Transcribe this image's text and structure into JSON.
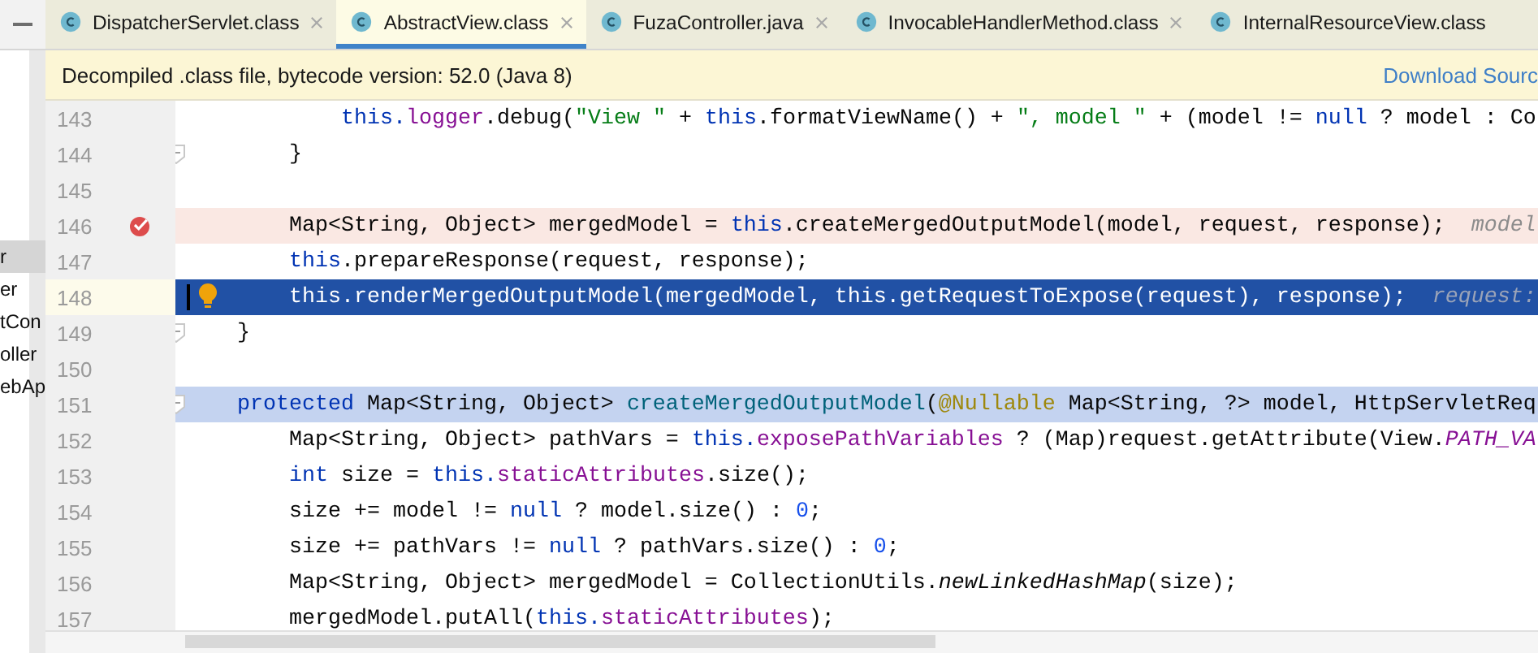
{
  "project_panel": {
    "items": [
      {
        "label": "r",
        "selected": true
      },
      {
        "label": "er",
        "selected": false
      },
      {
        "label": "tCon",
        "selected": false
      },
      {
        "label": "oller",
        "selected": false
      },
      {
        "label": "ebAp",
        "selected": false
      }
    ]
  },
  "tabs": [
    {
      "label": "DispatcherServlet.class",
      "selected": false,
      "closable": true
    },
    {
      "label": "AbstractView.class",
      "selected": true,
      "closable": true
    },
    {
      "label": "FuzaController.java",
      "selected": false,
      "closable": true
    },
    {
      "label": "InvocableHandlerMethod.class",
      "selected": false,
      "closable": true
    },
    {
      "label": "InternalResourceView.class",
      "selected": false,
      "closable": false
    }
  ],
  "banner": {
    "message": "Decompiled .class file, bytecode version: 52.0 (Java 8)",
    "link": "Download Sourc"
  },
  "editor": {
    "lines": [
      {
        "number": "143",
        "breakpoint": false,
        "current": false,
        "highlighted": false,
        "intention": false,
        "fold": false,
        "tokens": [
          {
            "text": "            this.",
            "kind": "keyword"
          },
          {
            "text": "logger",
            "kind": "field"
          },
          {
            "text": ".debug(",
            "kind": "plain"
          },
          {
            "text": "\"View \"",
            "kind": "string"
          },
          {
            "text": " + ",
            "kind": "plain"
          },
          {
            "text": "this",
            "kind": "keyword"
          },
          {
            "text": ".formatViewName() + ",
            "kind": "plain"
          },
          {
            "text": "\", model \"",
            "kind": "string"
          },
          {
            "text": " + (model != ",
            "kind": "plain"
          },
          {
            "text": "null",
            "kind": "keyword"
          },
          {
            "text": " ? model : Co",
            "kind": "plain"
          }
        ]
      },
      {
        "number": "144",
        "breakpoint": false,
        "current": false,
        "highlighted": false,
        "intention": false,
        "fold": true,
        "tokens": [
          {
            "text": "        }",
            "kind": "plain"
          }
        ]
      },
      {
        "number": "145",
        "breakpoint": false,
        "current": false,
        "highlighted": false,
        "intention": false,
        "fold": false
      },
      {
        "number": "146",
        "breakpoint": true,
        "current": false,
        "highlighted": false,
        "intention": false,
        "fold": false,
        "tokens": [
          {
            "text": "        Map<String, Object> mergedModel = ",
            "kind": "plain"
          },
          {
            "text": "this",
            "kind": "keyword"
          },
          {
            "text": ".createMergedOutputModel(model, request, response);",
            "kind": "plain"
          }
        ],
        "hint": "model"
      },
      {
        "number": "147",
        "breakpoint": false,
        "current": false,
        "highlighted": false,
        "intention": false,
        "fold": false,
        "tokens": [
          {
            "text": "        this",
            "kind": "keyword"
          },
          {
            "text": ".prepareResponse(request, response);",
            "kind": "plain"
          }
        ]
      },
      {
        "number": "148",
        "breakpoint": false,
        "current": true,
        "highlighted": false,
        "intention": true,
        "fold": false,
        "tokens": [
          {
            "text": "        this",
            "kind": "keyword"
          },
          {
            "text": ".renderMergedOutputModel(mergedModel, ",
            "kind": "plain"
          },
          {
            "text": "this",
            "kind": "keyword"
          },
          {
            "text": ".getRequestToExpose(request), response);",
            "kind": "plain"
          }
        ],
        "hint": "request:"
      },
      {
        "number": "149",
        "breakpoint": false,
        "current": false,
        "highlighted": false,
        "intention": false,
        "fold": true,
        "tokens": [
          {
            "text": "    }",
            "kind": "plain"
          }
        ]
      },
      {
        "number": "150",
        "breakpoint": false,
        "current": false,
        "highlighted": false,
        "intention": false,
        "fold": false
      },
      {
        "number": "151",
        "breakpoint": false,
        "current": false,
        "highlighted": true,
        "intention": false,
        "fold": true,
        "tokens": [
          {
            "text": "    protected",
            "kind": "keyword"
          },
          {
            "text": " Map<String, Object> ",
            "kind": "plain"
          },
          {
            "text": "createMergedOutputModel",
            "kind": "declaration"
          },
          {
            "text": "(",
            "kind": "plain"
          },
          {
            "text": "@Nullable",
            "kind": "annotation"
          },
          {
            "text": " Map<String, ?> model, HttpServletReq",
            "kind": "plain"
          }
        ]
      },
      {
        "number": "152",
        "breakpoint": false,
        "current": false,
        "highlighted": false,
        "intention": false,
        "fold": false,
        "tokens": [
          {
            "text": "        Map<String, Object> pathVars = ",
            "kind": "plain"
          },
          {
            "text": "this.",
            "kind": "keyword"
          },
          {
            "text": "exposePathVariables",
            "kind": "field"
          },
          {
            "text": " ? (Map)request.getAttribute(View.",
            "kind": "plain"
          },
          {
            "text": "PATH_VA",
            "kind": "static"
          }
        ]
      },
      {
        "number": "153",
        "breakpoint": false,
        "current": false,
        "highlighted": false,
        "intention": false,
        "fold": false,
        "tokens": [
          {
            "text": "        int",
            "kind": "keyword"
          },
          {
            "text": " size = ",
            "kind": "plain"
          },
          {
            "text": "this.",
            "kind": "keyword"
          },
          {
            "text": "staticAttributes",
            "kind": "field"
          },
          {
            "text": ".size();",
            "kind": "plain"
          }
        ]
      },
      {
        "number": "154",
        "breakpoint": false,
        "current": false,
        "highlighted": false,
        "intention": false,
        "fold": false,
        "tokens": [
          {
            "text": "        size += model != ",
            "kind": "plain"
          },
          {
            "text": "null",
            "kind": "keyword"
          },
          {
            "text": " ? model.size() : ",
            "kind": "plain"
          },
          {
            "text": "0",
            "kind": "number"
          },
          {
            "text": ";",
            "kind": "plain"
          }
        ]
      },
      {
        "number": "155",
        "breakpoint": false,
        "current": false,
        "highlighted": false,
        "intention": false,
        "fold": false,
        "tokens": [
          {
            "text": "        size += pathVars != ",
            "kind": "plain"
          },
          {
            "text": "null",
            "kind": "keyword"
          },
          {
            "text": " ? pathVars.size() : ",
            "kind": "plain"
          },
          {
            "text": "0",
            "kind": "number"
          },
          {
            "text": ";",
            "kind": "plain"
          }
        ]
      },
      {
        "number": "156",
        "breakpoint": false,
        "current": false,
        "highlighted": false,
        "intention": false,
        "fold": false,
        "tokens": [
          {
            "text": "        Map<String, Object> mergedModel = CollectionUtils.",
            "kind": "plain"
          },
          {
            "text": "newLinkedHashMap",
            "kind": "italic"
          },
          {
            "text": "(size);",
            "kind": "plain"
          }
        ]
      },
      {
        "number": "157",
        "breakpoint": false,
        "current": false,
        "highlighted": false,
        "intention": false,
        "fold": false,
        "tokens": [
          {
            "text": "        mergedModel.putAll(",
            "kind": "plain"
          },
          {
            "text": "this.",
            "kind": "keyword"
          },
          {
            "text": "staticAttributes",
            "kind": "field"
          },
          {
            "text": ");",
            "kind": "plain"
          }
        ]
      }
    ]
  }
}
